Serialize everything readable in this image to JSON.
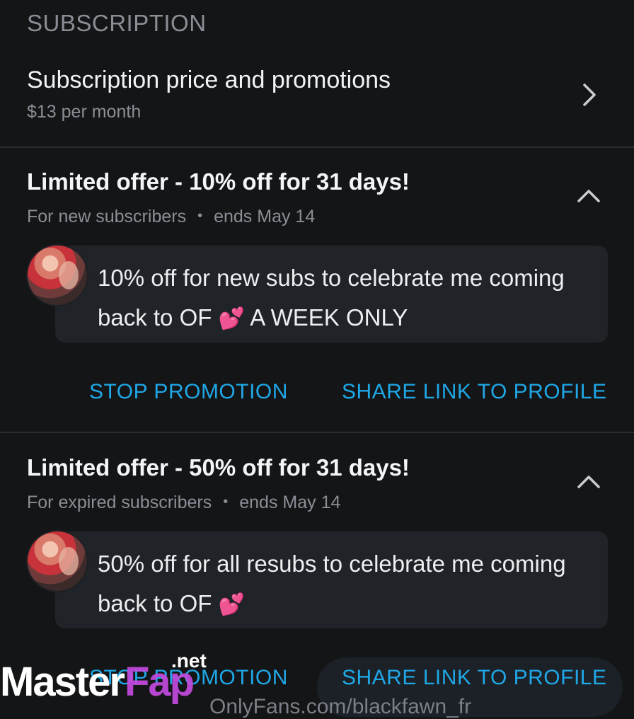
{
  "section": {
    "header": "SUBSCRIPTION"
  },
  "price": {
    "title": "Subscription price and promotions",
    "subtitle": "$13 per month",
    "chevron_icon": "chevron-right-icon"
  },
  "promotions": [
    {
      "title": "Limited offer - 10% off for 31 days!",
      "audience": "For new subscribers",
      "separator": "•",
      "ends": "ends May 14",
      "message_part1": "10% off for new subs to celebrate me coming back to OF ",
      "heart": "💕",
      "message_part2": " A WEEK ONLY",
      "stop_label": "STOP PROMOTION",
      "share_label": "SHARE LINK TO PROFILE"
    },
    {
      "title": "Limited offer - 50% off for 31 days!",
      "audience": "For expired subscribers",
      "separator": "•",
      "ends": "ends May 14",
      "message_part1": "50% off for all resubs to celebrate me coming back to OF ",
      "heart": "💕",
      "message_part2": "",
      "stop_label": "STOP PROMOTION",
      "share_label": "SHARE LINK TO PROFILE"
    }
  ],
  "watermark": {
    "master": "Master",
    "fap": "Fap",
    "net": ".net"
  },
  "footer": {
    "partial_url": "OnlyFans.com/blackfawn_fr"
  },
  "colors": {
    "accent": "#1fa7e6",
    "background": "#141517",
    "bubble": "#202327",
    "muted": "#8a8f96"
  }
}
